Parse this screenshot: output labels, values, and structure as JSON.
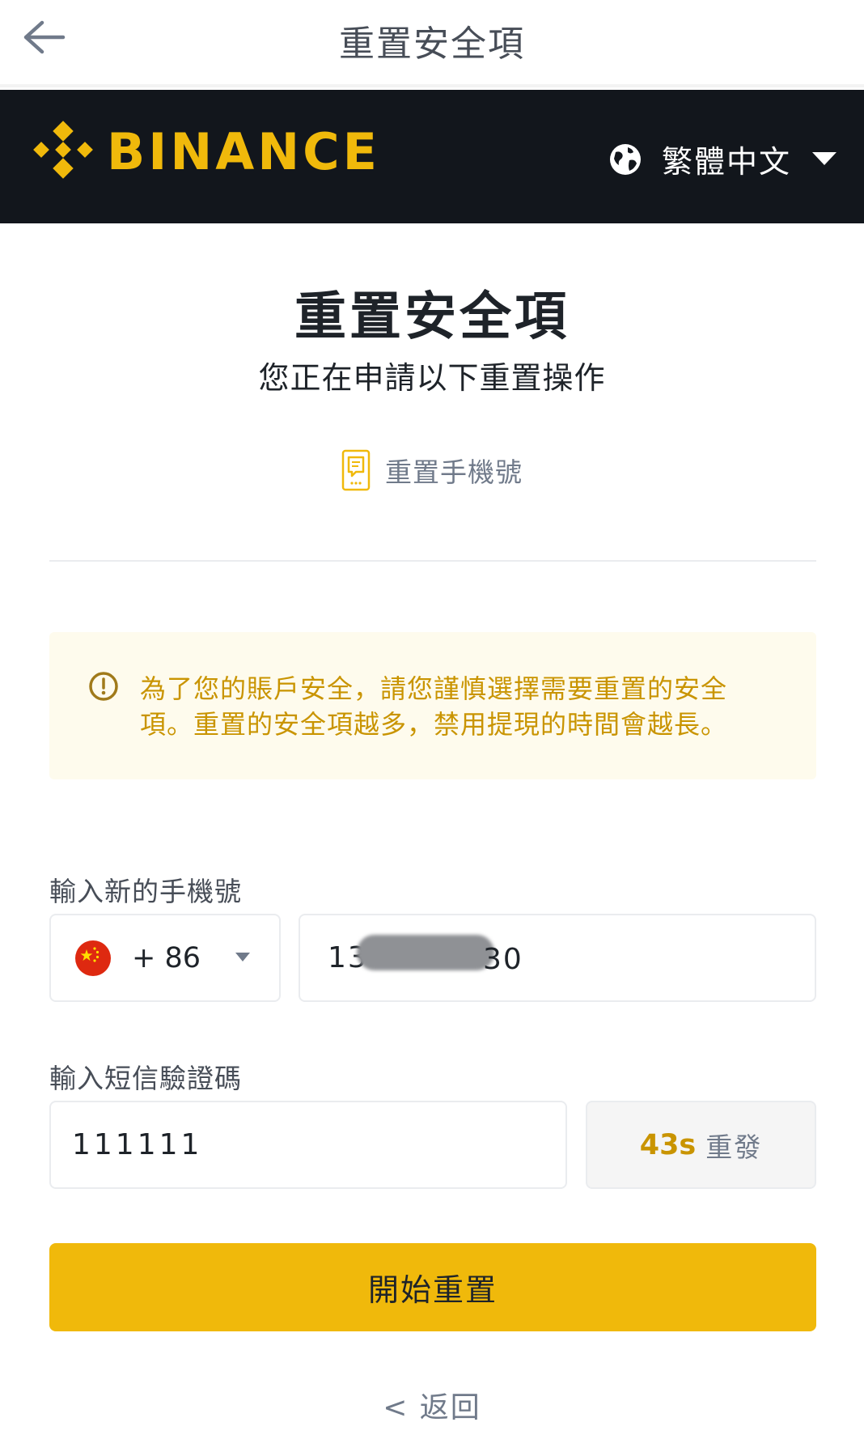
{
  "header": {
    "title": "重置安全項"
  },
  "brand": {
    "name": "BINANCE",
    "accent": "#f0b90b",
    "background": "#12161c"
  },
  "language": {
    "label": "繁體中文"
  },
  "main": {
    "title": "重置安全項",
    "subtitle": "您正在申請以下重置操作",
    "reset_item": "重置手機號"
  },
  "notice": {
    "text": "為了您的賬戶安全，請您謹慎選擇需要重置的安全項。重置的安全項越多，禁用提現的時間會越長。"
  },
  "phone_section": {
    "label": "輸入新的手機號",
    "country_code": "+ 86",
    "country_flag": "china-flag",
    "phone_prefix": "13",
    "phone_suffix": "30"
  },
  "sms_section": {
    "label": "輸入短信驗證碼",
    "code_value": "111111",
    "countdown": "43s",
    "resend_label": "重發"
  },
  "actions": {
    "primary_label": "開始重置",
    "back_label": "< 返回"
  }
}
